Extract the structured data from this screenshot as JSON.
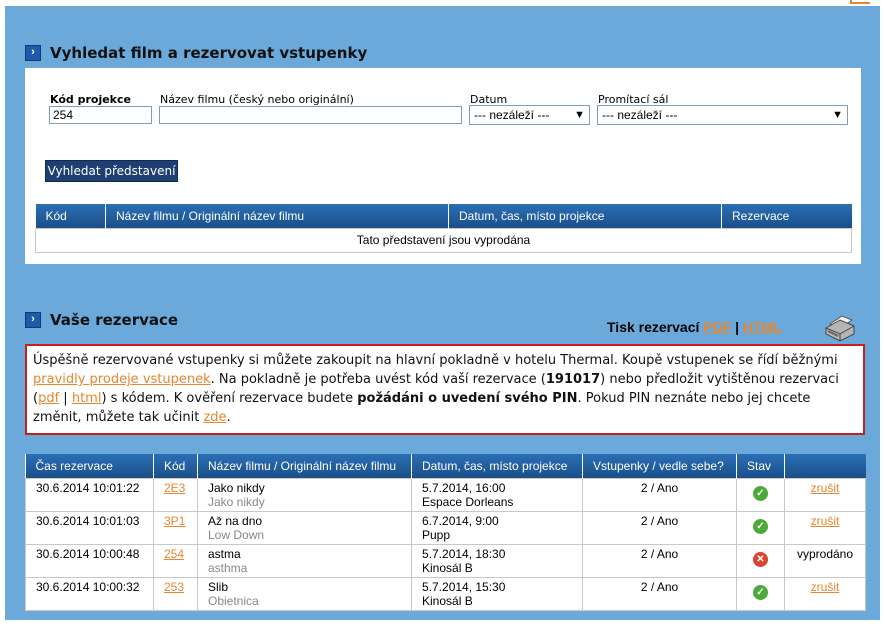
{
  "search": {
    "title": "Vyhledat film a rezervovat vstupenky",
    "code_label": "Kód projekce",
    "code_value": "254",
    "title_label": "Název filmu (český nebo originální)",
    "date_label": "Datum",
    "date_value": "--- nezáleží ---",
    "hall_label": "Promítací sál",
    "hall_value": "--- nezáleží ---",
    "button": "Vyhledat představení",
    "columns": [
      "Kód",
      "Název filmu / Originální název filmu",
      "Datum, čas, místo projekce",
      "Rezervace"
    ],
    "empty": "Tato představení jsou vyprodána"
  },
  "reservations": {
    "title": "Vaše rezervace",
    "print_label": "Tisk rezervací",
    "print_pdf": "PDF",
    "print_sep": "|",
    "print_html": "HTML",
    "info": {
      "p1": "Úspěšně rezervované vstupenky si můžete zakoupit na hlavní pokladně v hotelu Thermal. Koupě vstupenek se řídí běžnými ",
      "link_rules": "pravidly prodeje vstupenek",
      "p2": ". Na pokladně je potřeba uvést kód vaší rezervace (",
      "code": "191017",
      "p3": ") nebo předložit vytištěnou rezervaci (",
      "link_pdf": "pdf",
      "sep": " | ",
      "link_html": "html",
      "p4": ") s kódem. K ověření rezervace budete ",
      "bold": "požádáni o uvedení svého PIN",
      "p5": ". Pokud PIN neznáte nebo jej chcete změnit, můžete tak učinit ",
      "link_here": "zde",
      "p6": "."
    },
    "columns": [
      "Čas rezervace",
      "Kód",
      "Název filmu / Originální název filmu",
      "Datum, čas, místo projekce",
      "Vstupenky / vedle sebe?",
      "Stav",
      ""
    ],
    "rows": [
      {
        "time": "30.6.2014 10:01:22",
        "code": "2E3",
        "title": "Jako nikdy",
        "orig": "Jako nikdy",
        "date": "5.7.2014, 16:00",
        "place": "Espace Dorleans",
        "tickets": "2 / Ano",
        "status": "ok",
        "action": "zrušit"
      },
      {
        "time": "30.6.2014 10:01:03",
        "code": "3P1",
        "title": "Až na dno",
        "orig": "Low Down",
        "date": "6.7.2014, 9:00",
        "place": "Pupp",
        "tickets": "2 / Ano",
        "status": "ok",
        "action": "zrušit"
      },
      {
        "time": "30.6.2014 10:00:48",
        "code": "254",
        "title": "astma",
        "orig": "asthma",
        "date": "5.7.2014, 18:30",
        "place": "Kinosál B",
        "tickets": "2 / Ano",
        "status": "error",
        "action": "vyprodáno"
      },
      {
        "time": "30.6.2014 10:00:32",
        "code": "253",
        "title": "Slib",
        "orig": "Obietnica",
        "date": "5.7.2014, 15:30",
        "place": "Kinosál B",
        "tickets": "2 / Ano",
        "status": "ok",
        "action": "zrušit"
      }
    ]
  },
  "colors": {
    "background": "#6aa9d9",
    "header": "#1e5592",
    "link": "#e6862f",
    "ok": "#4caa38",
    "error": "#d9442f",
    "alert_border": "#c81e1e"
  }
}
